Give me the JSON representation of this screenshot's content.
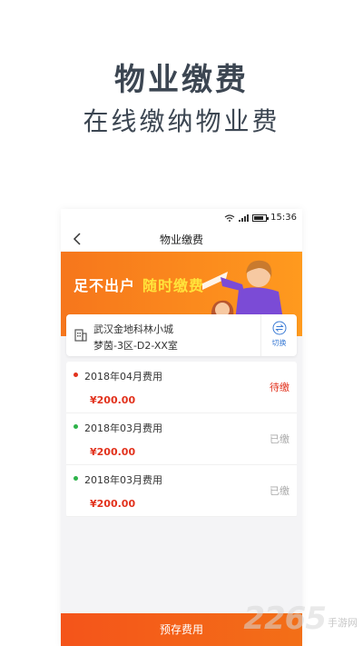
{
  "promo": {
    "title": "物业缴费",
    "subtitle": "在线缴纳物业费"
  },
  "statusbar": {
    "time": "15:36"
  },
  "navbar": {
    "title": "物业缴费"
  },
  "banner": {
    "text_white": "足不出户",
    "text_yellow": "随时缴费"
  },
  "address": {
    "community": "武汉金地科林小城",
    "unit": "梦茵-3区-D2-XX室",
    "switch_label": "切换"
  },
  "bills": [
    {
      "month": "2018年04月费用",
      "amount": "¥200.00",
      "status": "待缴",
      "dot_color": "#e2321d",
      "status_color": "#e2321d"
    },
    {
      "month": "2018年03月费用",
      "amount": "¥200.00",
      "status": "已缴",
      "dot_color": "#2db34a",
      "status_color": "#aaaaaa"
    },
    {
      "month": "2018年03月费用",
      "amount": "¥200.00",
      "status": "已缴",
      "dot_color": "#2db34a",
      "status_color": "#aaaaaa"
    }
  ],
  "footer": {
    "prepay_label": "预存费用"
  },
  "watermark": {
    "number": "2265",
    "site": "手游网"
  },
  "colors": {
    "accent": "#f36f17",
    "pending": "#e2321d",
    "paid": "#aaaaaa"
  }
}
